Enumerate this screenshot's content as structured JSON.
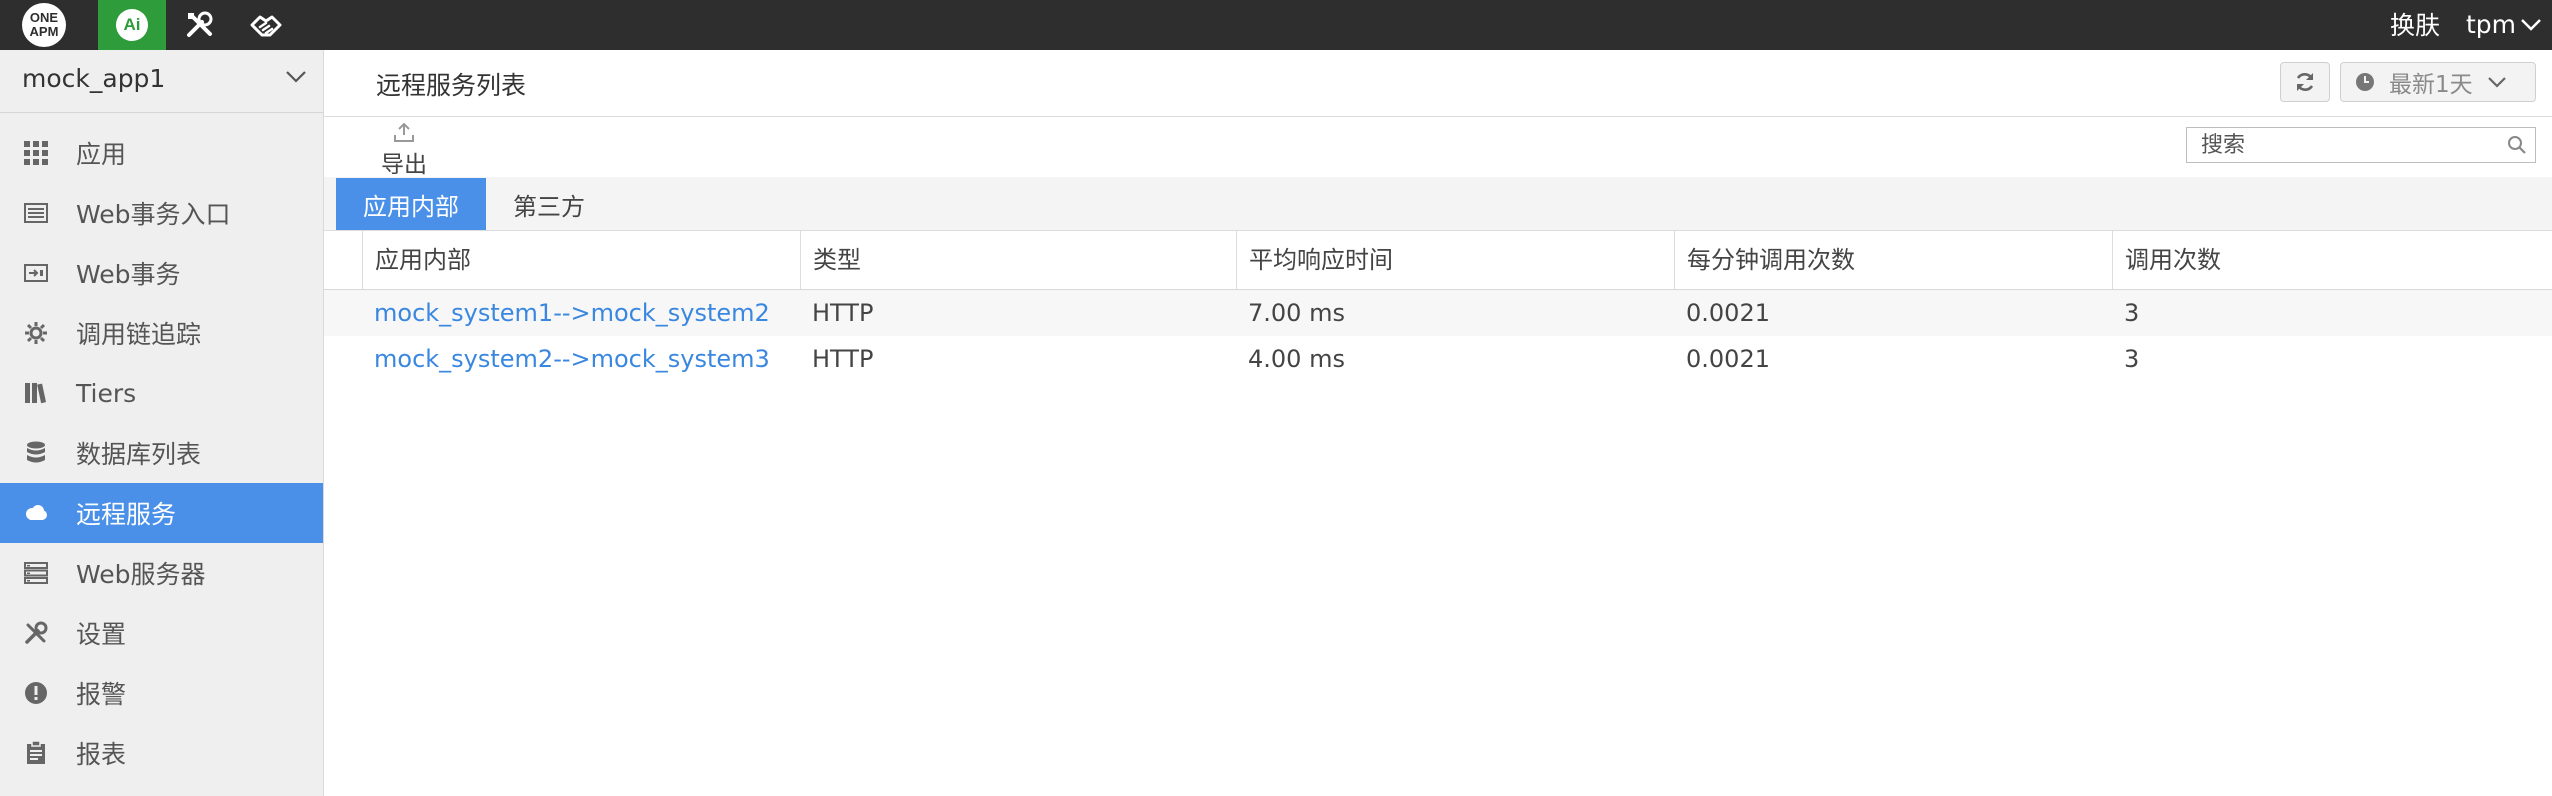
{
  "topbar": {
    "logo_line1": "ONE",
    "logo_line2": "APM",
    "ai_label": "Ai",
    "skin_label": "换肤",
    "user_label": "tpm",
    "icons": [
      "tools-icon",
      "handshake-icon"
    ]
  },
  "sidebar": {
    "app_name": "mock_app1",
    "items": [
      {
        "label": "应用",
        "icon": "grid-icon",
        "active": false
      },
      {
        "label": "Web事务入口",
        "icon": "list-icon",
        "active": false
      },
      {
        "label": "Web事务",
        "icon": "transaction-icon",
        "active": false
      },
      {
        "label": "调用链追踪",
        "icon": "gear-icon",
        "active": false
      },
      {
        "label": "Tiers",
        "icon": "books-icon",
        "active": false
      },
      {
        "label": "数据库列表",
        "icon": "database-icon",
        "active": false
      },
      {
        "label": "远程服务",
        "icon": "cloud-icon",
        "active": true
      },
      {
        "label": "Web服务器",
        "icon": "server-icon",
        "active": false
      },
      {
        "label": "设置",
        "icon": "wrench-icon",
        "active": false
      },
      {
        "label": "报警",
        "icon": "alert-icon",
        "active": false
      },
      {
        "label": "报表",
        "icon": "clipboard-icon",
        "active": false
      }
    ]
  },
  "header": {
    "title": "远程服务列表",
    "time_range": "最新1天"
  },
  "toolbar": {
    "export_label": "导出",
    "search_placeholder": "搜索"
  },
  "tabs": [
    {
      "label": "应用内部",
      "active": true
    },
    {
      "label": "第三方",
      "active": false
    }
  ],
  "table": {
    "columns": [
      "应用内部",
      "类型",
      "平均响应时间",
      "每分钟调用次数",
      "调用次数"
    ],
    "rows": [
      [
        "mock_system1-->mock_system2",
        "HTTP",
        "7.00 ms",
        "0.0021",
        "3"
      ],
      [
        "mock_system2-->mock_system3",
        "HTTP",
        "4.00 ms",
        "0.0021",
        "3"
      ]
    ]
  },
  "colors": {
    "topbar": "#2e2e2e",
    "ai_green": "#2f9c3b",
    "accent_blue": "#4a90e8",
    "link_blue": "#3a87e0"
  }
}
